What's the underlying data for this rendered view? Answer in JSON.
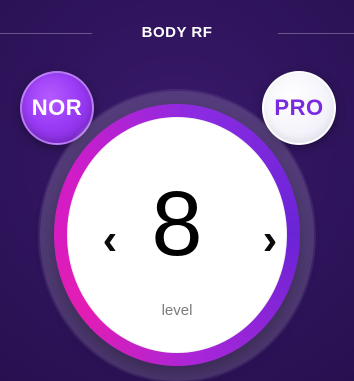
{
  "header": {
    "title": "BODY RF"
  },
  "modes": {
    "nor_label": "NOR",
    "pro_label": "PRO",
    "selected": "NOR"
  },
  "dial": {
    "value": "8",
    "label": "level",
    "left_arrow_icon": "chevron-left-icon",
    "right_arrow_icon": "chevron-right-icon"
  },
  "colors": {
    "background": "#2F145C",
    "nor_button": "#9A3CF6",
    "pro_text": "#7A2BE0",
    "ring_pink": "#E31DB3",
    "ring_purple": "#6A24D6"
  }
}
